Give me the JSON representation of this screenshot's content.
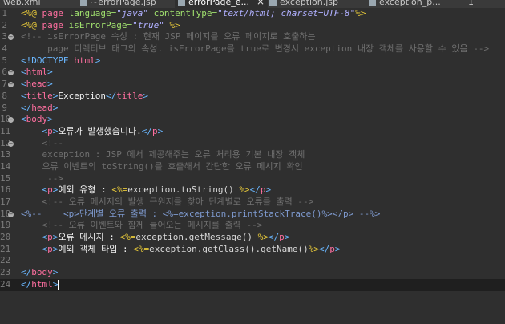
{
  "tabs": [
    {
      "label": "web.xml",
      "active": false
    },
    {
      "label": "~errorPage.jsp",
      "active": false
    },
    {
      "label": "errorPage_e...",
      "active": true,
      "close": "×"
    },
    {
      "label": "exception.jsp",
      "active": false
    },
    {
      "label": "exception_p...",
      "active": false
    },
    {
      "label": "1",
      "active": false
    }
  ],
  "lines": [
    {
      "n": "1",
      "fold": "",
      "segs": [
        [
          "<%@ ",
          "d-yel"
        ],
        [
          "page ",
          "d-key"
        ],
        [
          "language=",
          "d-attr"
        ],
        [
          "\"java\" ",
          "d-val"
        ],
        [
          "contentType=",
          "d-attr"
        ],
        [
          "\"text/html; charset=UTF-8\"",
          "d-val"
        ],
        [
          "%>",
          "d-yel"
        ]
      ]
    },
    {
      "n": "2",
      "fold": "",
      "segs": [
        [
          "<%@ ",
          "d-yel"
        ],
        [
          "page ",
          "d-key"
        ],
        [
          "isErrorPage=",
          "d-attr"
        ],
        [
          "\"true\" ",
          "d-val"
        ],
        [
          "%>",
          "d-yel"
        ]
      ]
    },
    {
      "n": "3",
      "fold": "−",
      "segs": [
        [
          "<!-- isErrorPage 속성 : 현재 JSP 페이지를 오류 페이지로 호출하는",
          "d-cmt"
        ]
      ]
    },
    {
      "n": "4",
      "fold": "",
      "segs": [
        [
          "     page 디렉티브 태그의 속성. isErrorPage를 true로 변경시 exception 내장 객체를 사용할 수 있음 -->",
          "d-cmt"
        ]
      ]
    },
    {
      "n": "5",
      "fold": "",
      "segs": [
        [
          "<!DOCTYPE ",
          "d-tag"
        ],
        [
          "html",
          "d-key"
        ],
        [
          ">",
          "d-tag"
        ]
      ]
    },
    {
      "n": "6",
      "fold": "−",
      "segs": [
        [
          "<",
          "d-tag"
        ],
        [
          "html",
          "d-key"
        ],
        [
          ">",
          "d-tag"
        ]
      ]
    },
    {
      "n": "7",
      "fold": "−",
      "segs": [
        [
          "<",
          "d-tag"
        ],
        [
          "head",
          "d-key"
        ],
        [
          ">",
          "d-tag"
        ]
      ]
    },
    {
      "n": "8",
      "fold": "",
      "segs": [
        [
          "<",
          "d-tag"
        ],
        [
          "title",
          "d-key"
        ],
        [
          ">",
          "d-tag"
        ],
        [
          "Exception",
          "d-txt"
        ],
        [
          "</",
          "d-tag"
        ],
        [
          "title",
          "d-key"
        ],
        [
          ">",
          "d-tag"
        ]
      ]
    },
    {
      "n": "9",
      "fold": "",
      "segs": [
        [
          "</",
          "d-tag"
        ],
        [
          "head",
          "d-key"
        ],
        [
          ">",
          "d-tag"
        ]
      ]
    },
    {
      "n": "10",
      "fold": "−",
      "segs": [
        [
          "<",
          "d-tag"
        ],
        [
          "body",
          "d-key"
        ],
        [
          ">",
          "d-tag"
        ]
      ]
    },
    {
      "n": "11",
      "fold": "",
      "segs": [
        [
          "    <",
          "d-tag"
        ],
        [
          "p",
          "d-key"
        ],
        [
          ">",
          "d-tag"
        ],
        [
          "오류가 발생했습니다.",
          "d-txt"
        ],
        [
          "</",
          "d-tag"
        ],
        [
          "p",
          "d-key"
        ],
        [
          ">",
          "d-tag"
        ]
      ]
    },
    {
      "n": "12",
      "fold": "−",
      "segs": [
        [
          "    <!--",
          "d-cmt"
        ]
      ]
    },
    {
      "n": "13",
      "fold": "",
      "segs": [
        [
          "    exception : JSP 에서 제공해주는 오류 처리용 기본 내장 객체",
          "d-cmt"
        ]
      ]
    },
    {
      "n": "14",
      "fold": "",
      "segs": [
        [
          "    오류 이벤트의 toString()를 호출해서 간단한 오류 메시지 확인",
          "d-cmt"
        ]
      ]
    },
    {
      "n": "15",
      "fold": "",
      "segs": [
        [
          "     -->",
          "d-cmt"
        ]
      ]
    },
    {
      "n": "16",
      "fold": "",
      "segs": [
        [
          "    <",
          "d-tag"
        ],
        [
          "p",
          "d-key"
        ],
        [
          ">",
          "d-tag"
        ],
        [
          "예외 유형 : ",
          "d-txt"
        ],
        [
          "<%=",
          "d-yel"
        ],
        [
          "exception.toString() ",
          "d-exp"
        ],
        [
          "%>",
          "d-yel"
        ],
        [
          "</",
          "d-tag"
        ],
        [
          "p",
          "d-key"
        ],
        [
          ">",
          "d-tag"
        ]
      ]
    },
    {
      "n": "17",
      "fold": "",
      "segs": [
        [
          "    <!-- 오류 메시지의 발생 근원지를 찾아 단계별로 오류를 출력 -->",
          "d-cmt"
        ]
      ]
    },
    {
      "n": "18",
      "fold": "−",
      "segs": [
        [
          "<%--    <p>단계별 오류 출력 : <%=exception.printStackTrace()%></p> --%>",
          "d-scmt"
        ]
      ]
    },
    {
      "n": "19",
      "fold": "",
      "segs": [
        [
          "    <!-- 오류 이벤트와 함께 들어오는 메시지를 출력 -->",
          "d-cmt"
        ]
      ]
    },
    {
      "n": "20",
      "fold": "",
      "segs": [
        [
          "    <",
          "d-tag"
        ],
        [
          "p",
          "d-key"
        ],
        [
          ">",
          "d-tag"
        ],
        [
          "오류 메시지 : ",
          "d-txt"
        ],
        [
          "<%=",
          "d-yel"
        ],
        [
          "exception.getMessage() ",
          "d-exp"
        ],
        [
          "%>",
          "d-yel"
        ],
        [
          "</",
          "d-tag"
        ],
        [
          "p",
          "d-key"
        ],
        [
          ">",
          "d-tag"
        ]
      ]
    },
    {
      "n": "21",
      "fold": "",
      "segs": [
        [
          "    <",
          "d-tag"
        ],
        [
          "p",
          "d-key"
        ],
        [
          ">",
          "d-tag"
        ],
        [
          "예외 객체 타입 : ",
          "d-txt"
        ],
        [
          "<%=",
          "d-yel"
        ],
        [
          "exception.getClass().getName()",
          "d-exp"
        ],
        [
          "%>",
          "d-yel"
        ],
        [
          "</",
          "d-tag"
        ],
        [
          "p",
          "d-key"
        ],
        [
          ">",
          "d-tag"
        ]
      ]
    },
    {
      "n": "22",
      "fold": "",
      "segs": []
    },
    {
      "n": "23",
      "fold": "",
      "segs": [
        [
          "</",
          "d-tag"
        ],
        [
          "body",
          "d-key"
        ],
        [
          ">",
          "d-tag"
        ]
      ]
    },
    {
      "n": "24",
      "fold": "",
      "segs": [
        [
          "</",
          "d-tag"
        ],
        [
          "html",
          "d-key"
        ],
        [
          ">",
          "d-tag"
        ]
      ],
      "current": true
    }
  ]
}
